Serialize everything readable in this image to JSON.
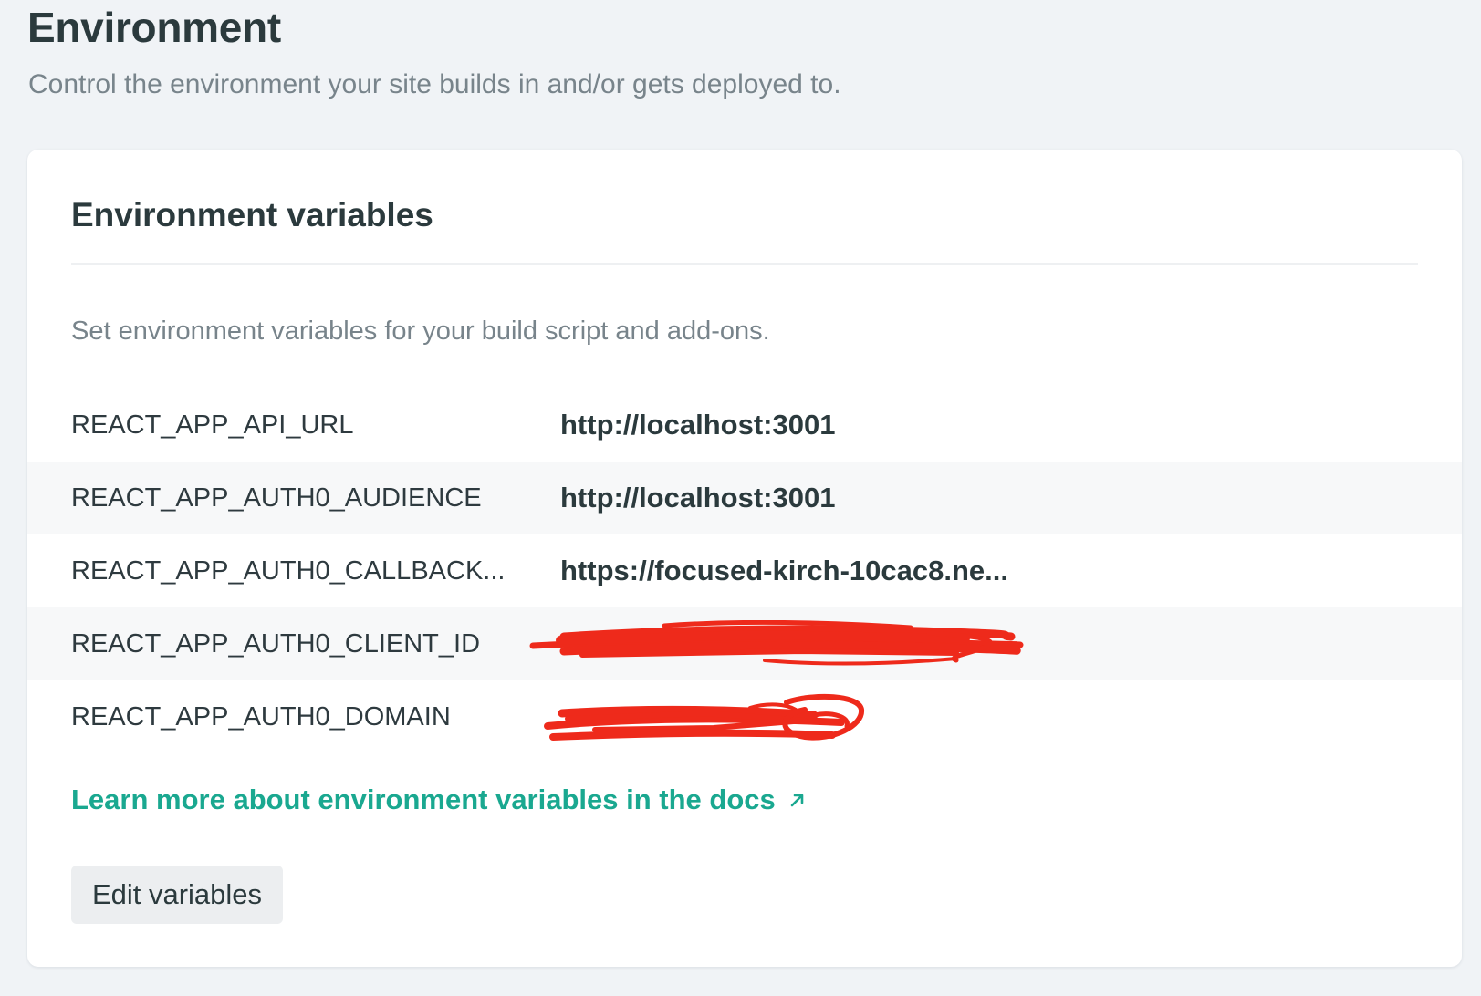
{
  "header": {
    "title": "Environment",
    "subtitle": "Control the environment your site builds in and/or gets deployed to."
  },
  "card": {
    "title": "Environment variables",
    "description": "Set environment variables for your build script and add-ons.",
    "variables": [
      {
        "key": "REACT_APP_API_URL",
        "value": "http://localhost:3001",
        "redacted": false
      },
      {
        "key": "REACT_APP_AUTH0_AUDIENCE",
        "value": "http://localhost:3001",
        "redacted": false
      },
      {
        "key": "REACT_APP_AUTH0_CALLBACK...",
        "value": "https://focused-kirch-10cac8.ne...",
        "redacted": false
      },
      {
        "key": "REACT_APP_AUTH0_CLIENT_ID",
        "value": "",
        "redacted": true
      },
      {
        "key": "REACT_APP_AUTH0_DOMAIN",
        "value": "",
        "redacted": true
      }
    ],
    "docs_link": {
      "label": "Learn more about environment variables in the docs",
      "icon": "external-link-arrow-icon"
    },
    "edit_button_label": "Edit variables"
  },
  "colors": {
    "background": "#f0f3f6",
    "card": "#ffffff",
    "link": "#1aa890",
    "redaction": "#ee2a1b",
    "alt_row": "#f7f8f9"
  }
}
